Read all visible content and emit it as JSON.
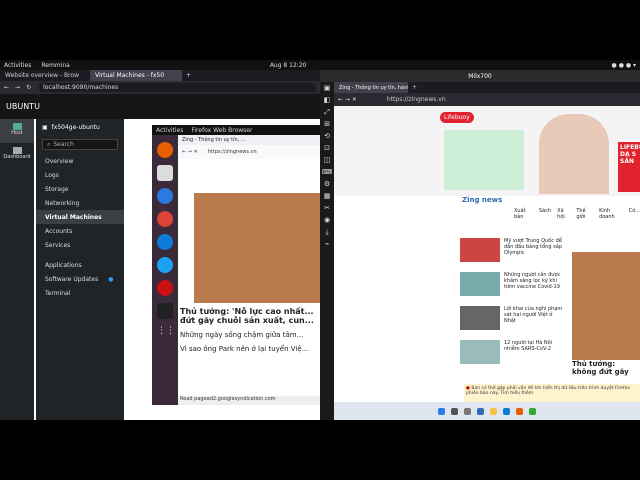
{
  "topbar": {
    "activities": "Activities",
    "app": "Remmina",
    "clock": "Aug 8  12:20"
  },
  "left_browser": {
    "tabs": [
      {
        "label": "Website overview - Brow"
      },
      {
        "label": "Virtual Machines - fx50"
      }
    ],
    "url": "localhost:9090/machines"
  },
  "cockpit": {
    "host_name": "UBUNTU",
    "rail": [
      {
        "label": "Host"
      },
      {
        "label": "Dashboard"
      }
    ],
    "machine_name": "fx504ge-ubuntu",
    "search_placeholder": "Search",
    "nav": [
      {
        "label": "Overview"
      },
      {
        "label": "Logs"
      },
      {
        "label": "Storage"
      },
      {
        "label": "Networking"
      },
      {
        "label": "Virtual Machines"
      },
      {
        "label": "Accounts"
      },
      {
        "label": "Services"
      },
      {
        "label": "Applications"
      },
      {
        "label": "Software Updates"
      },
      {
        "label": "Terminal"
      }
    ]
  },
  "vm": {
    "activities": "Activities",
    "app": "Firefox Web Browser",
    "tab": "Zing - Thông tin uy tín, ...",
    "url": "https://zingnews.vn",
    "headline": "Thủ tướng: 'Nỗ lực cao nhất... đứt gãy chuỗi sản xuất, cun...",
    "line1": "Những ngày sống chậm giữa tâm...",
    "line2": "Vì sao ông Park nên ở lại tuyển Việ...",
    "status": "Read pagead2.googlesyndication.com"
  },
  "right_window": {
    "title": "Milx700",
    "tab": "Zing - Thông tin uy tín, hành tử...",
    "url": "https://zingnews.vn",
    "banner_brand": "Lifebuoy",
    "banner_side": "LIFEBUY DA S SẢN",
    "site_logo": "Zing news",
    "nav": [
      "Xuất bản",
      "Sách",
      "Xã hội",
      "Thế giới",
      "Kinh doanh",
      "Cô..."
    ],
    "news": [
      {
        "text": "Mỹ vượt Trung Quốc để dẫn đầu bảng tổng sắp Olympic"
      },
      {
        "text": "Những người cần được khám sàng lọc kỹ khi tiêm vaccine Covid-19"
      },
      {
        "text": "Lời khai của nghi phạm sát hại người Việt ở Nhật"
      },
      {
        "text": "12 người tại Hà Nội nhiễm SARS-CoV-2"
      }
    ],
    "side_headline": "Thủ tướng: không đứt gãy",
    "notice": "Bạn có thể gặp phải vấn đề khi hiển thị dữ liệu trên trình duyệt Firefox phiên bản này. Tìm hiểu thêm"
  }
}
